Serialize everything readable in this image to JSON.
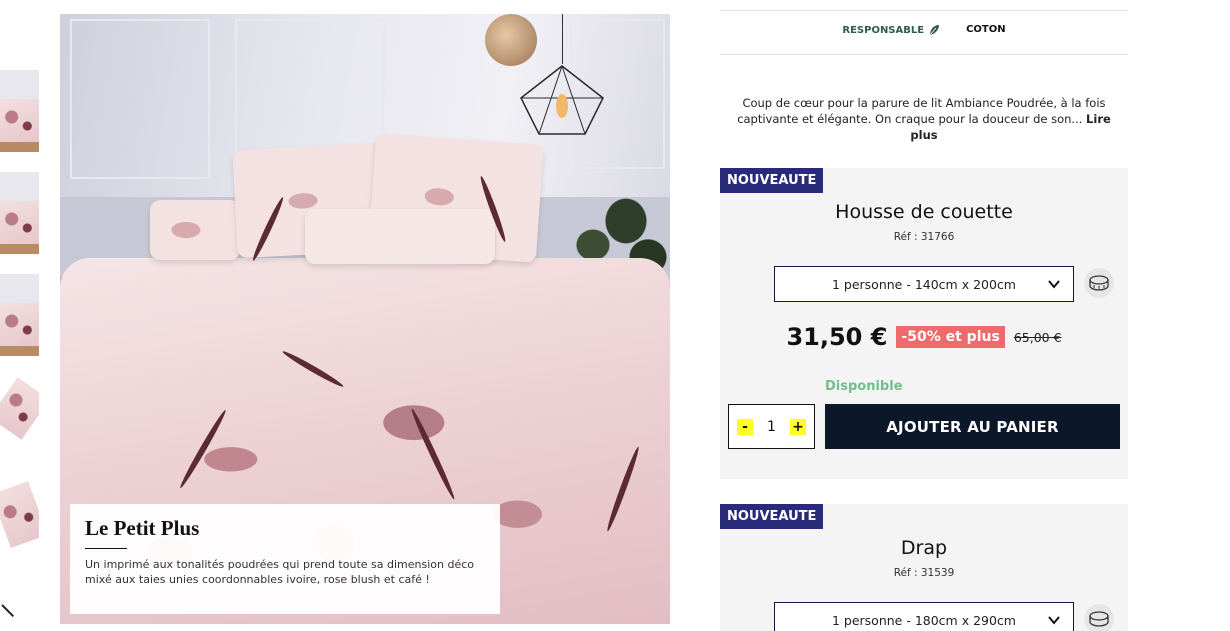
{
  "tags": {
    "responsible": "RESPONSABLE",
    "material": "COTON"
  },
  "description": {
    "text": "Coup de cœur pour la parure de lit Ambiance Poudrée, à la fois captivante et élégante. On craque pour la douceur de son...",
    "more": "Lire plus"
  },
  "info_box": {
    "title": "Le Petit Plus",
    "text": "Un imprimé aux tonalités poudrées qui prend toute sa dimension déco mixé aux taies unies coordonnables ivoire, rose blush et café !"
  },
  "products": [
    {
      "badge": "NOUVEAUTE",
      "title": "Housse de couette",
      "ref": "Réf : 31766",
      "size": "1 personne - 140cm x 200cm",
      "price": "31,50 €",
      "discount": "-50% et plus",
      "old_price": "65,00 €",
      "stock": "Disponible",
      "quantity": "1",
      "minus": "-",
      "plus": "+",
      "add_to_cart": "AJOUTER AU PANIER"
    },
    {
      "badge": "NOUVEAUTE",
      "title": "Drap",
      "ref": "Réf : 31539",
      "size": "1 personne - 180cm x 290cm"
    }
  ],
  "colors": {
    "badge": "#2a2a7a",
    "discount": "#ef6a6a",
    "stock": "#6fc08c",
    "cart_button": "#0c1729",
    "qty_highlight": "#ffff22",
    "responsible": "#2f5e46"
  },
  "icons": {
    "responsible": "leaf-icon",
    "size_guide": "tape-measure-icon",
    "select": "chevron-down-icon"
  }
}
